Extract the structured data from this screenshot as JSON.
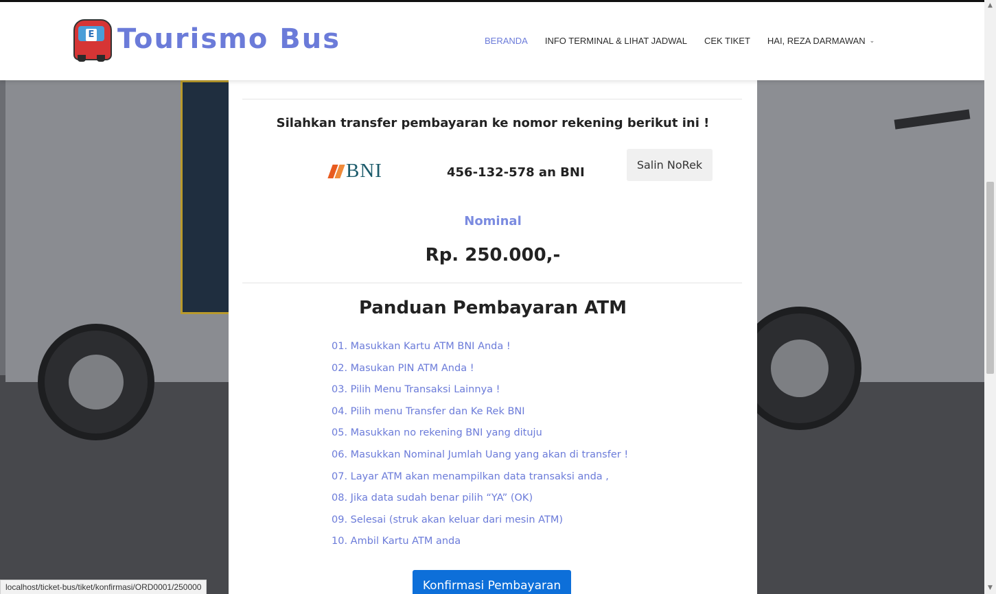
{
  "brand": {
    "name": "Tourismo Bus",
    "logo_badge": "E",
    "accent": "#6b7bd9"
  },
  "nav": {
    "items": [
      {
        "label": "BERANDA",
        "active": true
      },
      {
        "label": "INFO TERMINAL & LIHAT JADWAL",
        "active": false
      },
      {
        "label": "CEK TIKET",
        "active": false
      },
      {
        "label": "HAI, REZA DARMAWAN",
        "active": false
      }
    ],
    "dropdown_glyph": "⌄"
  },
  "payment": {
    "instruction": "Silahkan transfer pembayaran ke nomor rekening berikut ini !",
    "bank_name": "BNI",
    "account_text": "456-132-578 an BNI",
    "copy_button": "Salin NoRek",
    "nominal_label": "Nominal",
    "nominal_value": "Rp. 250.000,-"
  },
  "guide": {
    "title": "Panduan Pembayaran ATM",
    "steps": [
      "01. Masukkan Kartu ATM BNI Anda !",
      "02. Masukan PIN ATM Anda !",
      "03. Pilih Menu Transaksi Lainnya !",
      "04. Pilih menu Transfer dan Ke Rek BNI",
      "05. Masukkan no rekening BNI yang dituju",
      "06. Masukkan Nominal Jumlah Uang yang akan di transfer !",
      "07. Layar ATM akan menampilkan data transaksi anda ,",
      "08. Jika data sudah benar pilih “YA” (OK)",
      "09. Selesai (struk akan keluar dari mesin ATM)",
      "10. Ambil Kartu ATM anda"
    ]
  },
  "actions": {
    "confirm_button": "Konfirmasi Pembayaran",
    "confirm_color": "#0d6fd9"
  },
  "browser": {
    "status_url": "localhost/ticket-bus/tiket/konfirmasi/ORD0001/250000"
  }
}
